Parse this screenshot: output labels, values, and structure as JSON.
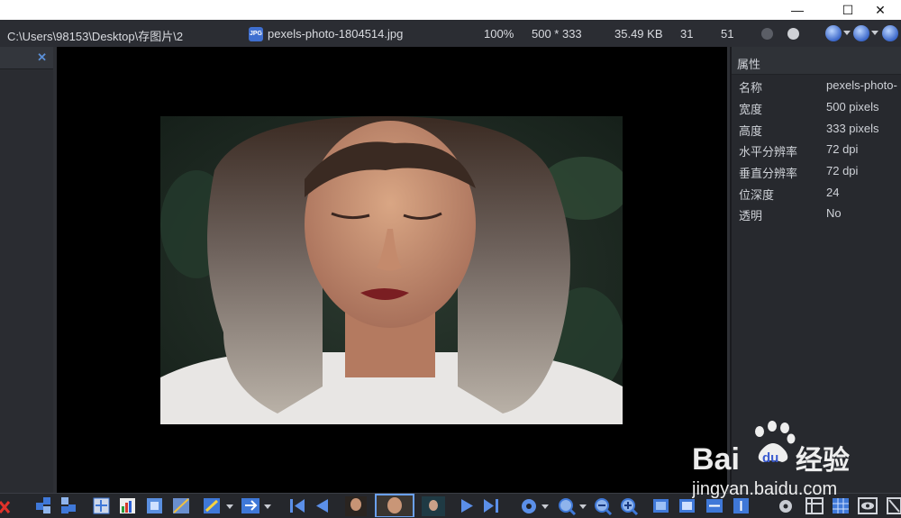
{
  "window": {
    "controls": [
      "—",
      "☐",
      "✕"
    ]
  },
  "infobar": {
    "path": "C:\\Users\\98153\\Desktop\\存图片\\2",
    "filename": "pexels-photo-1804514.jpg",
    "zoom": "100%",
    "dimensions": "500 * 333",
    "filesize": "35.49 KB",
    "num1": "31",
    "num2": "51"
  },
  "properties": {
    "header": "属性",
    "rows": [
      {
        "key": "名称",
        "value": "pexels-photo-"
      },
      {
        "key": "宽度",
        "value": "500 pixels"
      },
      {
        "key": "高度",
        "value": "333 pixels"
      },
      {
        "key": "水平分辨率",
        "value": "72 dpi"
      },
      {
        "key": "垂直分辨率",
        "value": "72 dpi"
      },
      {
        "key": "位深度",
        "value": "24"
      },
      {
        "key": "透明",
        "value": "No"
      }
    ]
  },
  "watermark": {
    "brand_bai": "Bai",
    "brand_du": "du",
    "brand_cn": "经验",
    "url": "jingyan.baidu.com"
  },
  "colors": {
    "accent_blue": "#3b67c9",
    "panel_bg": "#27292e",
    "viewer_bg": "#000000"
  }
}
